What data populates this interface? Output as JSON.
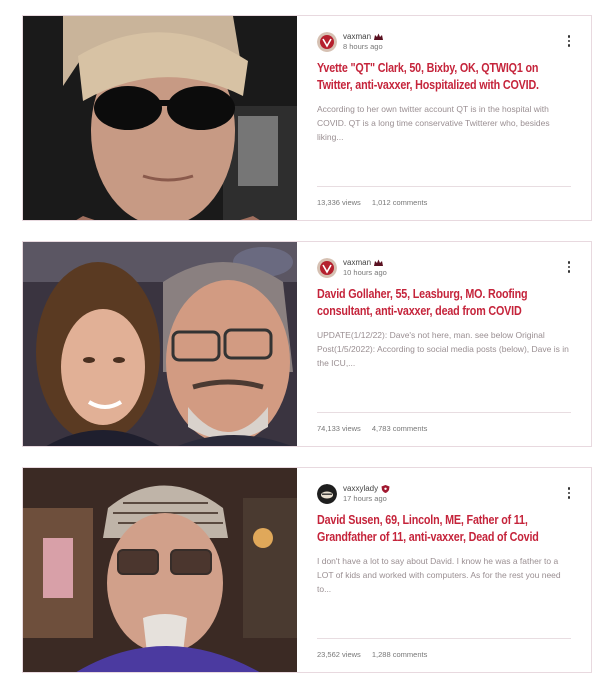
{
  "posts": [
    {
      "author": "vaxman",
      "author_badge": "crown-icon",
      "time": "8 hours ago",
      "title": "Yvette \"QT\" Clark, 50, Bixby, OK, QTWIQ1 on Twitter, anti-vaxxer, Hospitalized with COVID.",
      "excerpt": "According to her own twitter account QT is in the hospital with COVID. QT is a long time conservative Twitterer who, besides liking...",
      "views": "13,336 views",
      "comments": "1,012 comments"
    },
    {
      "author": "vaxman",
      "author_badge": "crown-icon",
      "time": "10 hours ago",
      "title": "David Gollaher, 55, Leasburg, MO. Roofing consultant, anti-vaxxer, dead from COVID",
      "excerpt": "UPDATE(1/12/22): Dave's not here, man. see below Original Post(1/5/2022): According to social media posts (below), Dave is in the ICU,...",
      "views": "74,133 views",
      "comments": "4,783 comments"
    },
    {
      "author": "vaxxylady",
      "author_badge": "shield-icon",
      "time": "17 hours ago",
      "title": "David Susen, 69, Lincoln, ME, Father of 11, Grandfather of 11, anti-vaxxer, Dead of Covid",
      "excerpt": "I don't have a lot to say about David. I know he was a father to a LOT of kids and worked with computers. As for the rest you need to...",
      "views": "23,562 views",
      "comments": "1,288 comments"
    }
  ],
  "colors": {
    "title": "#c5243b",
    "border": "#e8d9df",
    "excerpt": "#9a8f92"
  }
}
